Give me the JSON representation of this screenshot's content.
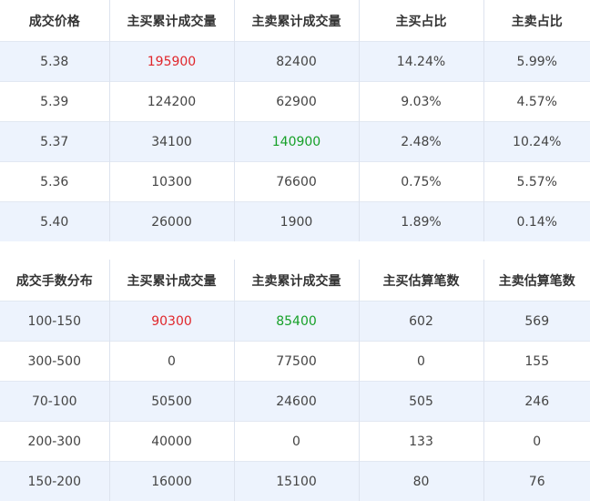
{
  "price_table": {
    "headers": [
      "成交价格",
      "主买累计成交量",
      "主卖累计成交量",
      "主买占比",
      "主卖占比"
    ],
    "rows": [
      [
        "5.38",
        "195900",
        "82400",
        "14.24%",
        "5.99%"
      ],
      [
        "5.39",
        "124200",
        "62900",
        "9.03%",
        "4.57%"
      ],
      [
        "5.37",
        "34100",
        "140900",
        "2.48%",
        "10.24%"
      ],
      [
        "5.36",
        "10300",
        "76600",
        "0.75%",
        "5.57%"
      ],
      [
        "5.40",
        "26000",
        "1900",
        "1.89%",
        "0.14%"
      ]
    ]
  },
  "lot_table": {
    "headers": [
      "成交手数分布",
      "主买累计成交量",
      "主卖累计成交量",
      "主买估算笔数",
      "主卖估算笔数"
    ],
    "rows": [
      [
        "100-150",
        "90300",
        "85400",
        "602",
        "569"
      ],
      [
        "300-500",
        "0",
        "77500",
        "0",
        "155"
      ],
      [
        "70-100",
        "50500",
        "24600",
        "505",
        "246"
      ],
      [
        "200-300",
        "40000",
        "0",
        "133",
        "0"
      ],
      [
        "150-200",
        "16000",
        "15100",
        "80",
        "76"
      ]
    ]
  },
  "colors": {
    "buy_highlight": "#e0262b",
    "sell_highlight": "#16a028",
    "row_stripe": "#edf3fd"
  }
}
